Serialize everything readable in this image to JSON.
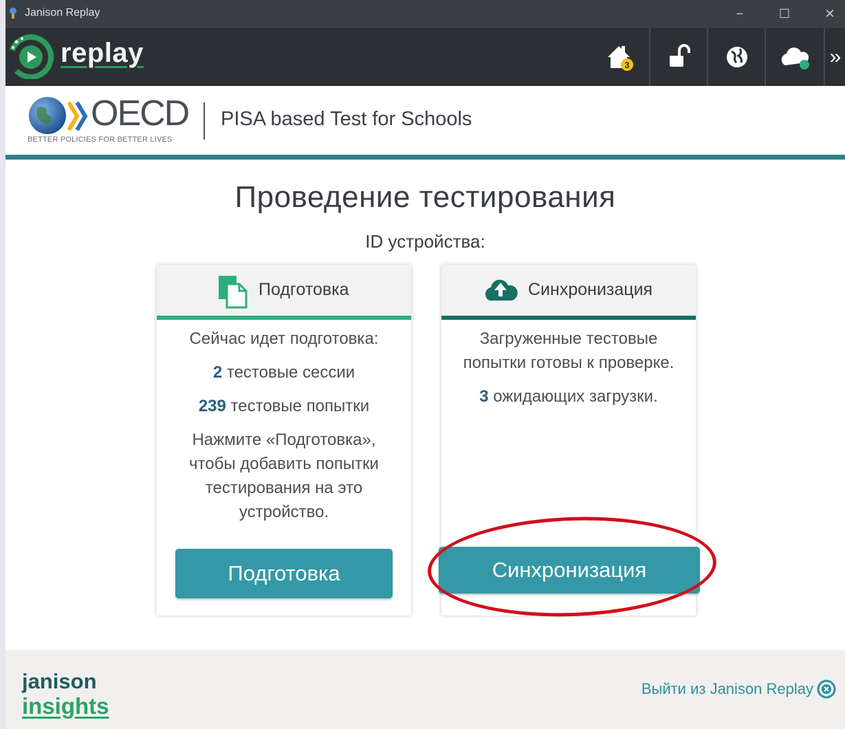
{
  "window": {
    "title": "Janison Replay",
    "controls": {
      "minimize": "−",
      "maximize": "☐",
      "close": "✕"
    }
  },
  "toolbar": {
    "logo_text": "replay",
    "home_badge": "3",
    "icons": [
      "home-icon",
      "unlock-icon",
      "globe-icon",
      "cloud-icon"
    ],
    "more": "»",
    "accent": "#2d9a5c"
  },
  "header": {
    "org_name": "OECD",
    "org_tagline": "BETTER POLICIES FOR BETTER LIVES",
    "product": "PISA based Test for Schools"
  },
  "main": {
    "title": "Проведение тестирования",
    "device_id_label": "ID устройства:",
    "prepare_card": {
      "heading": "Подготовка",
      "status": "Сейчас идет подготовка:",
      "sessions_count": "2",
      "sessions_label": "тестовые сессии",
      "attempts_count": "239",
      "attempts_label": "тестовые попытки",
      "instruction": "Нажмите «Подготовка», чтобы добавить попытки тестирования на это устройство.",
      "button": "Подготовка",
      "accent": "#2bb07a"
    },
    "sync_card": {
      "heading": "Синхронизация",
      "status": "Загруженные тестовые попытки готовы к проверке.",
      "pending_count": "3",
      "pending_label": "ожидающих загрузки.",
      "button": "Синхронизация",
      "accent": "#166f66"
    },
    "button_color": "#3498a6"
  },
  "footer": {
    "brand_line1": "janison",
    "brand_line2": "insights",
    "exit_link": "Выйти из Janison Replay"
  }
}
